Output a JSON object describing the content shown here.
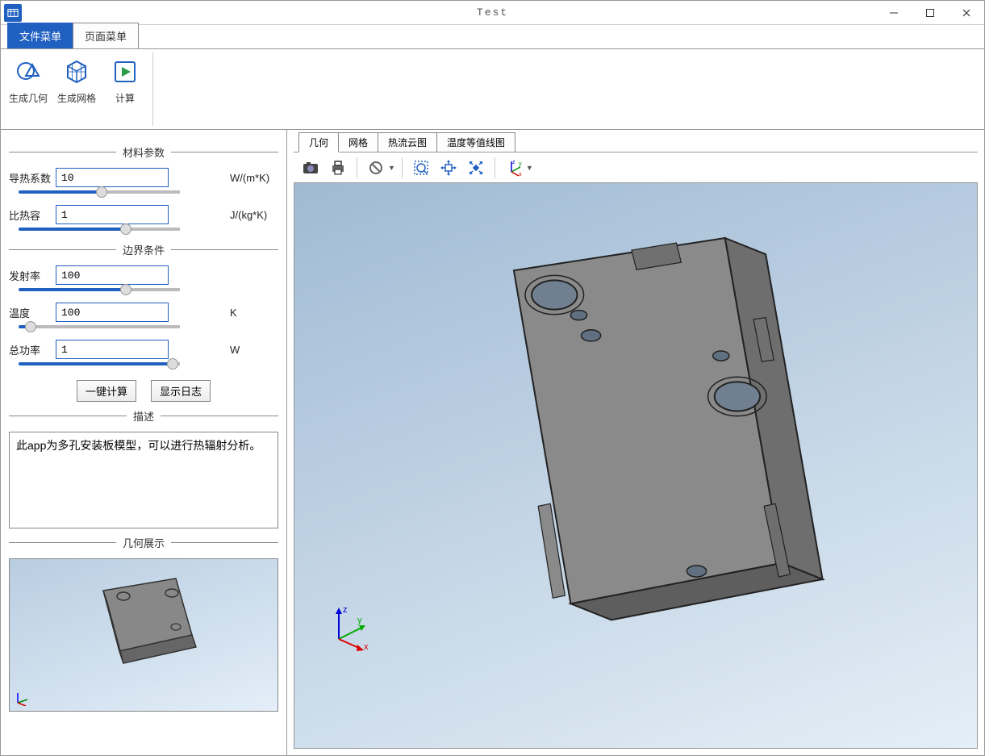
{
  "window": {
    "title": "Test"
  },
  "menutabs": {
    "file": "文件菜单",
    "page": "页面菜单"
  },
  "ribbon": {
    "geom": "生成几何",
    "mesh": "生成网格",
    "calc": "计算"
  },
  "sections": {
    "material": "材料参数",
    "boundary": "边界条件",
    "description": "描述",
    "preview": "几何展示"
  },
  "params": {
    "conductivity": {
      "label": "导热系数",
      "value": "10",
      "unit": "W/(m*K)"
    },
    "specific_heat": {
      "label": "比热容",
      "value": "1",
      "unit": "J/(kg*K)"
    },
    "emissivity": {
      "label": "发射率",
      "value": "100",
      "unit": ""
    },
    "temperature": {
      "label": "温度",
      "value": "100",
      "unit": "K"
    },
    "power": {
      "label": "总功率",
      "value": "1",
      "unit": "W"
    }
  },
  "buttons": {
    "compute": "一键计算",
    "showlog": "显示日志"
  },
  "description_text": "此app为多孔安装板模型，可以进行热辐射分析。",
  "viewtabs": {
    "geom": "几何",
    "mesh": "网格",
    "heatflow": "热流云图",
    "isotherm": "温度等值线图"
  }
}
